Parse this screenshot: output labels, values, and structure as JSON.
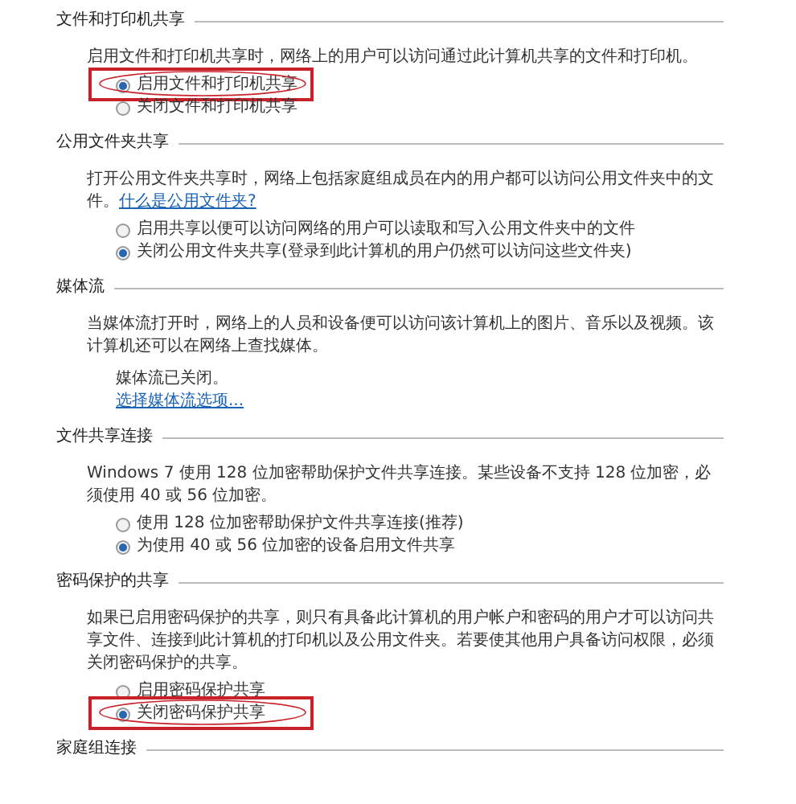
{
  "sections": [
    {
      "title": "文件和打印机共享",
      "items": [
        {
          "kind": "text",
          "text": "启用文件和打印机共享时，网络上的用户可以访问通过此计算机共享的文件和打印机。"
        },
        {
          "kind": "radio",
          "label": "启用文件和打印机共享",
          "selected": true,
          "highlighted": true
        },
        {
          "kind": "radio",
          "label": "关闭文件和打印机共享",
          "selected": false,
          "highlighted": false
        }
      ]
    },
    {
      "title": "公用文件夹共享",
      "items": [
        {
          "kind": "text",
          "text": "打开公用文件夹共享时，网络上包括家庭组成员在内的用户都可以访问公用文件夹中的文件。",
          "link": "什么是公用文件夹?"
        },
        {
          "kind": "radio",
          "label": "启用共享以便可以访问网络的用户可以读取和写入公用文件夹中的文件",
          "selected": false,
          "highlighted": false
        },
        {
          "kind": "radio",
          "label": "关闭公用文件夹共享(登录到此计算机的用户仍然可以访问这些文件夹)",
          "selected": true,
          "highlighted": false
        }
      ]
    },
    {
      "title": "媒体流",
      "items": [
        {
          "kind": "text",
          "text": "当媒体流打开时，网络上的人员和设备便可以访问该计算机上的图片、音乐以及视频。该计算机还可以在网络上查找媒体。"
        },
        {
          "kind": "status",
          "text": "媒体流已关闭。"
        },
        {
          "kind": "link",
          "text": "选择媒体流选项..."
        }
      ]
    },
    {
      "title": "文件共享连接",
      "items": [
        {
          "kind": "text",
          "text": "Windows 7 使用 128 位加密帮助保护文件共享连接。某些设备不支持 128 位加密，必须使用 40 或 56 位加密。"
        },
        {
          "kind": "radio",
          "label": "使用 128 位加密帮助保护文件共享连接(推荐)",
          "selected": false,
          "highlighted": false
        },
        {
          "kind": "radio",
          "label": "为使用 40 或 56 位加密的设备启用文件共享",
          "selected": true,
          "highlighted": false
        }
      ]
    },
    {
      "title": "密码保护的共享",
      "items": [
        {
          "kind": "text",
          "text": "如果已启用密码保护的共享，则只有具备此计算机的用户帐户和密码的用户才可以访问共享文件、连接到此计算机的打印机以及公用文件夹。若要使其他用户具备访问权限，必须关闭密码保护的共享。"
        },
        {
          "kind": "radio",
          "label": "启用密码保护共享",
          "selected": false,
          "highlighted": false
        },
        {
          "kind": "radio",
          "label": "关闭密码保护共享",
          "selected": true,
          "highlighted": true
        }
      ]
    },
    {
      "title": "家庭组连接"
    }
  ]
}
